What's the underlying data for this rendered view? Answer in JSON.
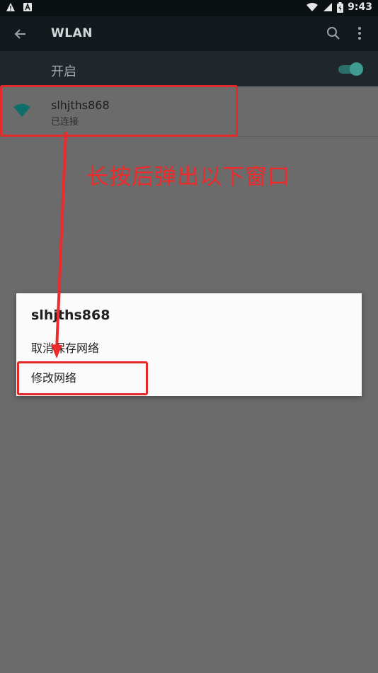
{
  "status_bar": {
    "time": "9:43",
    "left_icons": [
      "warning-icon",
      "notification-a-icon"
    ],
    "right_icons": [
      "wifi-signal-icon",
      "cell-signal-icon",
      "battery-icon"
    ]
  },
  "app_bar": {
    "title": "WLAN",
    "back_icon": "arrow-left-icon",
    "search_icon": "search-icon",
    "more_icon": "more-vert-icon"
  },
  "master_switch": {
    "label": "开启",
    "enabled": true
  },
  "network": {
    "name": "slhjths868",
    "status": "已连接"
  },
  "annotation": {
    "text": "长按后弹出以下窗口",
    "color": "#ee2b2b"
  },
  "dialog": {
    "title": "slhjths868",
    "items": [
      "取消保存网络",
      "修改网络"
    ]
  },
  "colors": {
    "accent": "#3f9c93",
    "wifi_icon": "#0f7a72",
    "scrim": "#6b6b6b"
  }
}
